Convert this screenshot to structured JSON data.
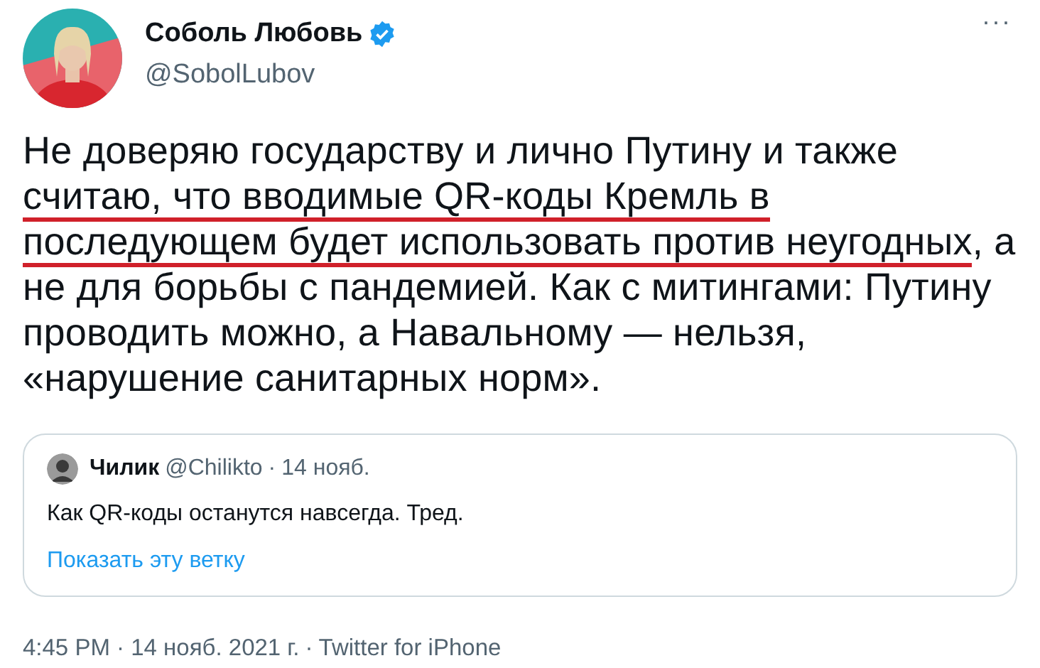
{
  "author": {
    "name": "Соболь Любовь",
    "verified": true,
    "handle": "@SobolLubov"
  },
  "more_button": "···",
  "body": [
    {
      "text": "Не доверяю государству и лично Путину и также ",
      "underlined": false
    },
    {
      "text": "считаю, что вводимые QR-коды Кремль в последующем будет использовать против неугодных",
      "underlined": true
    },
    {
      "text": ", а не для борьбы с пандемией. Как с митингами: Путину проводить можно, а Навальному — нельзя, «нарушение санитарных норм».",
      "underlined": false
    }
  ],
  "quoted_tweet": {
    "name": "Чилик",
    "handle": "@Chilikto",
    "separator": "·",
    "date": "14 нояб.",
    "text": "Как QR-коды останутся навсегда. Тред.",
    "thread_link": "Показать эту ветку"
  },
  "footer": {
    "timestamp": "4:45 PM · 14 нояб. 2021 г.",
    "separator": "·",
    "source": "Twitter for iPhone"
  }
}
